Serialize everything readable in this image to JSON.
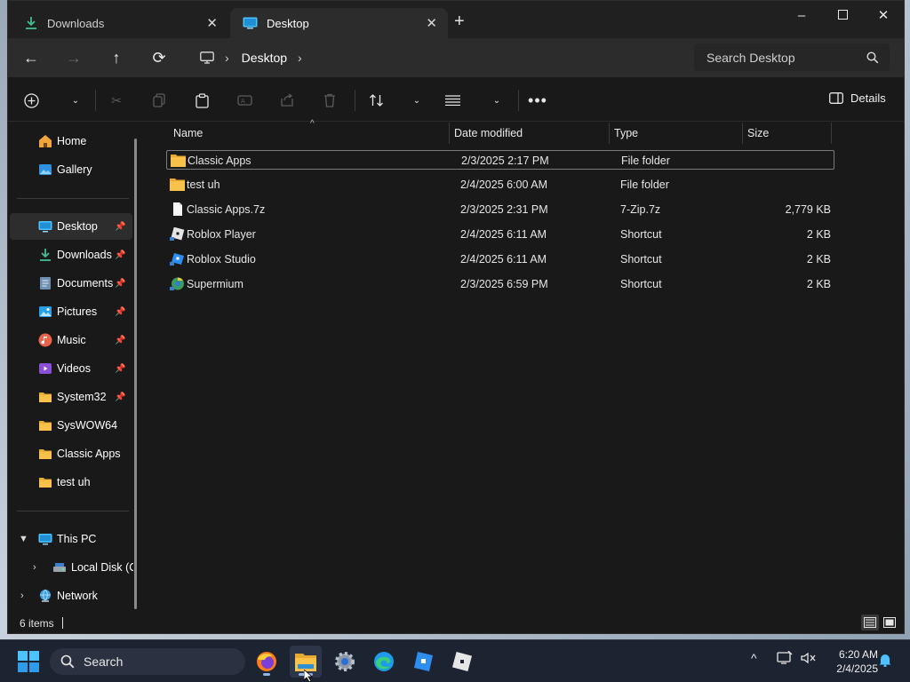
{
  "tabs": [
    {
      "label": "Downloads",
      "icon": "download-icon",
      "active": false
    },
    {
      "label": "Desktop",
      "icon": "desktop-icon",
      "active": true
    }
  ],
  "window_controls": {
    "minimize": "–",
    "maximize": "☐",
    "close": "✕"
  },
  "nav": {
    "back": "←",
    "forward": "→",
    "up": "↑",
    "refresh": "⟳",
    "breadcrumb": [
      "Desktop"
    ],
    "search_placeholder": "Search Desktop"
  },
  "toolbar": {
    "details_label": "Details"
  },
  "sidebar": {
    "items": [
      {
        "label": "Home",
        "icon": "home-icon",
        "pinned": false
      },
      {
        "label": "Gallery",
        "icon": "gallery-icon",
        "pinned": false
      },
      {
        "label": "Desktop",
        "icon": "desktop-icon",
        "pinned": true,
        "selected": true
      },
      {
        "label": "Downloads",
        "icon": "download-icon",
        "pinned": true
      },
      {
        "label": "Documents",
        "icon": "documents-icon",
        "pinned": true
      },
      {
        "label": "Pictures",
        "icon": "pictures-icon",
        "pinned": true
      },
      {
        "label": "Music",
        "icon": "music-icon",
        "pinned": true
      },
      {
        "label": "Videos",
        "icon": "videos-icon",
        "pinned": true
      },
      {
        "label": "System32",
        "icon": "folder-icon",
        "pinned": true
      },
      {
        "label": "SysWOW64",
        "icon": "folder-icon",
        "pinned": false
      },
      {
        "label": "Classic Apps",
        "icon": "folder-icon",
        "pinned": false
      },
      {
        "label": "test uh",
        "icon": "folder-icon",
        "pinned": false
      }
    ],
    "this_pc": "This PC",
    "local_disk": "Local Disk (C:",
    "network": "Network"
  },
  "columns": [
    "Name",
    "Date modified",
    "Type",
    "Size"
  ],
  "files": [
    {
      "name": "Classic Apps",
      "date": "2/3/2025 2:17 PM",
      "type": "File folder",
      "size": "",
      "icon": "folder-icon"
    },
    {
      "name": "test uh",
      "date": "2/4/2025 6:00 AM",
      "type": "File folder",
      "size": "",
      "icon": "folder-icon"
    },
    {
      "name": "Classic Apps.7z",
      "date": "2/3/2025 2:31 PM",
      "type": "7-Zip.7z",
      "size": "2,779 KB",
      "icon": "file-icon"
    },
    {
      "name": "Roblox Player",
      "date": "2/4/2025 6:11 AM",
      "type": "Shortcut",
      "size": "2 KB",
      "icon": "roblox-player-icon"
    },
    {
      "name": "Roblox Studio",
      "date": "2/4/2025 6:11 AM",
      "type": "Shortcut",
      "size": "2 KB",
      "icon": "roblox-studio-icon"
    },
    {
      "name": "Supermium",
      "date": "2/3/2025 6:59 PM",
      "type": "Shortcut",
      "size": "2 KB",
      "icon": "supermium-icon"
    }
  ],
  "status": {
    "item_count": "6 items"
  },
  "taskbar": {
    "search_label": "Search",
    "time": "6:20 AM",
    "date": "2/4/2025"
  },
  "colors": {
    "accent": "#4cc2ff",
    "folder": "#f7c14a",
    "selection_border": "#7a7a7a"
  }
}
